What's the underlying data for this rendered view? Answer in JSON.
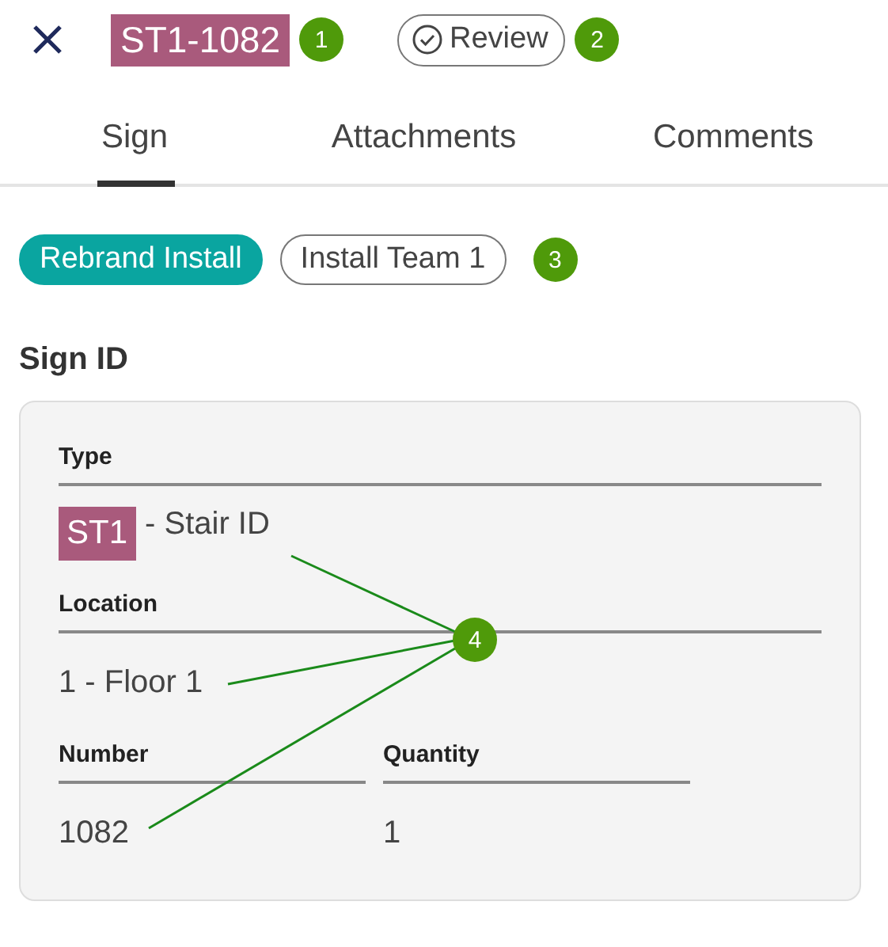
{
  "header": {
    "title": "ST1-1082",
    "status": "Review"
  },
  "tabs": [
    {
      "label": "Sign",
      "selected": true
    },
    {
      "label": "Attachments",
      "selected": false
    },
    {
      "label": "Comments",
      "selected": false
    }
  ],
  "tags": [
    {
      "label": "Rebrand Install",
      "kind": "filled"
    },
    {
      "label": "Install Team 1",
      "kind": "outline"
    }
  ],
  "section_title": "Sign ID",
  "fields": {
    "type": {
      "label": "Type",
      "code": "ST1",
      "value": "- Stair ID"
    },
    "location": {
      "label": "Location",
      "value": "1 - Floor 1"
    },
    "number": {
      "label": "Number",
      "value": "1082"
    },
    "quantity": {
      "label": "Quantity",
      "value": "1"
    }
  },
  "callouts": [
    "1",
    "2",
    "3",
    "4"
  ]
}
